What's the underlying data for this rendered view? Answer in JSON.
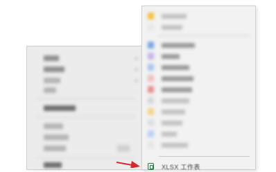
{
  "parent_menu": {
    "items": [
      {
        "has_submenu": true
      },
      {
        "has_submenu": true
      },
      {
        "has_submenu": true
      },
      {
        "has_submenu": false
      },
      {
        "has_submenu": false
      },
      {
        "has_submenu": false
      },
      {
        "has_submenu": false
      }
    ]
  },
  "new_submenu": {
    "last_item": {
      "label": "XLSX 工作表",
      "icon": "xlsx-file-icon"
    },
    "colors": {
      "xlsx_green": "#1f7a3e",
      "pointer_red": "#d42a2a"
    }
  }
}
